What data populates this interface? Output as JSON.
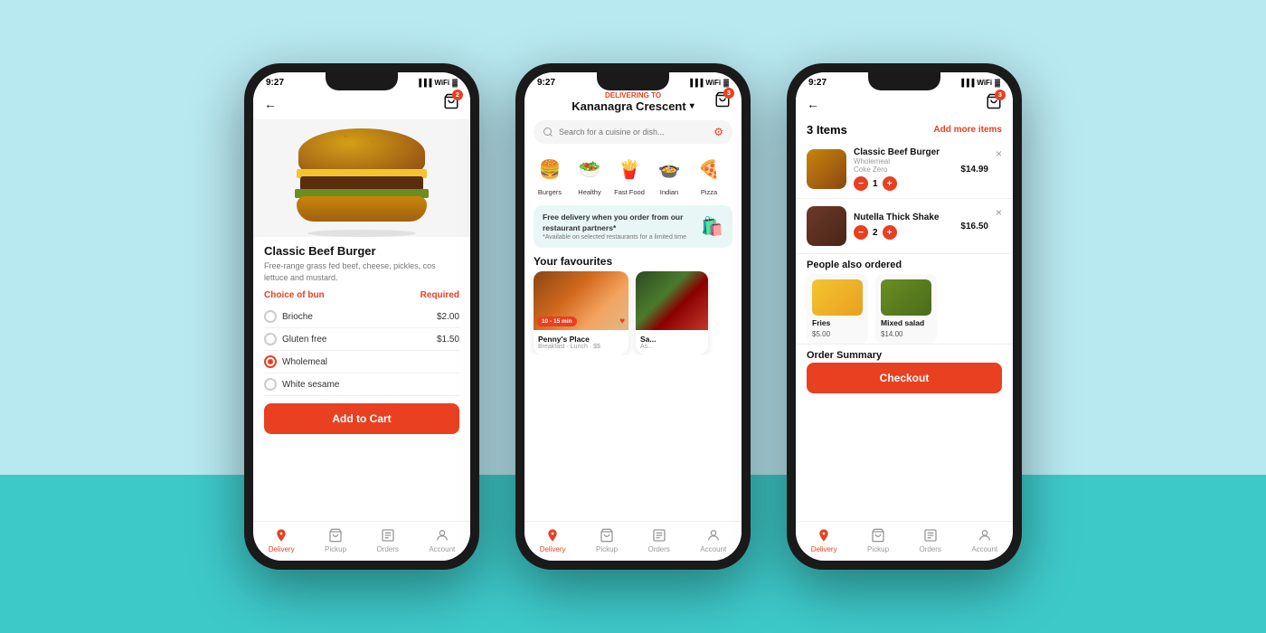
{
  "phones": {
    "phone1": {
      "time": "9:27",
      "hero_alt": "Classic Beef Burger",
      "title": "Classic Beef Burger",
      "description": "Free-range grass fed beef, cheese, pickles, cos lettuce and mustard.",
      "bun_section": "Choice of bun",
      "required_label": "Required",
      "options": [
        {
          "name": "Brioche",
          "price": "$2.00",
          "selected": false
        },
        {
          "name": "Gluten free",
          "price": "$1.50",
          "selected": false
        },
        {
          "name": "Wholemeal",
          "price": "",
          "selected": true
        },
        {
          "name": "White sesame",
          "price": "",
          "selected": false
        }
      ],
      "add_to_cart": "Add to Cart",
      "nav": [
        "Delivery",
        "Pickup",
        "Orders",
        "Account"
      ],
      "cart_badge": "2"
    },
    "phone2": {
      "time": "9:27",
      "delivering_to": "DELIVERING TO",
      "location": "Kananagra Crescent",
      "search_placeholder": "Search for a cuisine or dish...",
      "categories": [
        {
          "emoji": "🍔",
          "label": "Burgers"
        },
        {
          "emoji": "🥗",
          "label": "Healthy"
        },
        {
          "emoji": "🍟",
          "label": "Fast Food"
        },
        {
          "emoji": "🍲",
          "label": "Indian"
        },
        {
          "emoji": "🍕",
          "label": "Piz..."
        }
      ],
      "promo_title": "Free delivery when you order from our restaurant partners*",
      "promo_sub": "*Available on selected restaurants for a limited time",
      "promo_emoji": "🛍️",
      "favourites_label": "Your favourites",
      "fav_cards": [
        {
          "name": "Penny's Place",
          "sub": "Breakfast · Lunch · $$",
          "time": "10 - 15 min",
          "heart": true
        },
        {
          "name": "Sa...",
          "sub": "As...",
          "time": "",
          "heart": false
        }
      ],
      "nav": [
        "Delivery",
        "Pickup",
        "Orders",
        "Account"
      ],
      "cart_badge": "3"
    },
    "phone3": {
      "time": "9:27",
      "items_count": "3 Items",
      "add_more": "Add more items",
      "cart_items": [
        {
          "name": "Classic Beef Burger",
          "sub1": "Wholemeal",
          "sub2": "Coke Zero",
          "qty": 1,
          "price": "$14.99"
        },
        {
          "name": "Nutella Thick Shake",
          "sub1": "",
          "sub2": "",
          "qty": 2,
          "price": "$16.50"
        }
      ],
      "also_ordered": "People also ordered",
      "suggestions": [
        {
          "name": "Fries",
          "price": "$5.00"
        },
        {
          "name": "Mixed salad",
          "price": "$14.00"
        }
      ],
      "order_summary": "Order Summary",
      "checkout": "Checkout",
      "nav": [
        "Delivery",
        "Pickup",
        "Orders",
        "Account"
      ],
      "cart_badge": "3"
    }
  }
}
